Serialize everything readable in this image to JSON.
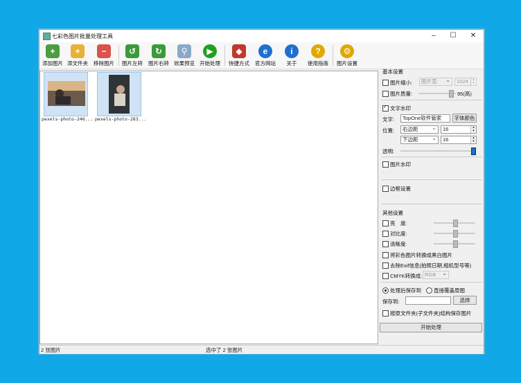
{
  "window": {
    "title": "七彩色图片批量处理工具",
    "min_icon": "–",
    "max_icon": "☐",
    "close_icon": "✕"
  },
  "toolbar": [
    {
      "label": "添加图片",
      "icon": "add-image",
      "color": "#4a9e3f",
      "glyph": "+"
    },
    {
      "label": "添文件夹",
      "icon": "add-folder",
      "color": "#e8b23a",
      "glyph": "+"
    },
    {
      "label": "移除图片",
      "icon": "remove-image",
      "color": "#d9534f",
      "glyph": "−"
    },
    {
      "label": "图片左转",
      "icon": "rotate-left",
      "color": "#3a9b3a",
      "glyph": "↺"
    },
    {
      "label": "图片右转",
      "icon": "rotate-right",
      "color": "#3a9b3a",
      "glyph": "↻"
    },
    {
      "label": "效果预览",
      "icon": "magnifier",
      "color": "#8aa9c9",
      "glyph": "⚲"
    },
    {
      "label": "开始处理",
      "icon": "play",
      "color": "#22a022",
      "glyph": "▶"
    },
    {
      "label": "快捷方式",
      "icon": "shortcut",
      "color": "#c0392b",
      "glyph": "◆"
    },
    {
      "label": "官方网站",
      "icon": "browser",
      "color": "#1f6fd0",
      "glyph": "e"
    },
    {
      "label": "关于",
      "icon": "info",
      "color": "#1f6fd0",
      "glyph": "i"
    },
    {
      "label": "使用指南",
      "icon": "help",
      "color": "#e0a800",
      "glyph": "?"
    },
    {
      "label": "图片设置",
      "icon": "settings",
      "color": "#e0a800",
      "glyph": "⚙"
    }
  ],
  "images": [
    {
      "name": "pexels-photo-246..."
    },
    {
      "name": "pexels-photo-283..."
    }
  ],
  "status": {
    "count": "2 张图片",
    "selected": "选中了 2 张图片"
  },
  "panel": {
    "basic_title": "基本设置",
    "resize_label": "图片缩小:",
    "resize_mode": "图片宽:",
    "resize_value": "1024",
    "quality_label": "图片质量:",
    "quality_value": "95(高)",
    "text_wm_label": "文字水印",
    "text_label": "文字:",
    "text_value": "TopOne软件管家",
    "font_color_btn": "字体颜色",
    "pos_label": "位置:",
    "pos_h": "右边距",
    "pos_h_val": "16",
    "pos_v": "下边距",
    "pos_v_val": "16",
    "opacity_label": "透明:",
    "opacity_level": 1.0,
    "img_wm_label": "图片水印",
    "border_label": "边框设置",
    "other_title": "其他设置",
    "brightness": "亮　度:",
    "contrast": "对比度:",
    "sharpness": "清晰度:",
    "bw_label": "将彩色图片转换成黑白图片",
    "exif_label": "去除Exif信息(拍照日期,相机型号等)",
    "cmyk_label": "CMYK转换成:",
    "cmyk_value": "RGB",
    "save_to_radio": "处理后保存到",
    "overwrite_radio": "直接覆盖原图",
    "save_to_label": "保存到:",
    "save_to_value": "",
    "choose_btn": "选择",
    "keep_structure": "按原文件夹(子文件夹)结构保存图片",
    "start_btn": "开始处理",
    "dots": "· · ·"
  }
}
